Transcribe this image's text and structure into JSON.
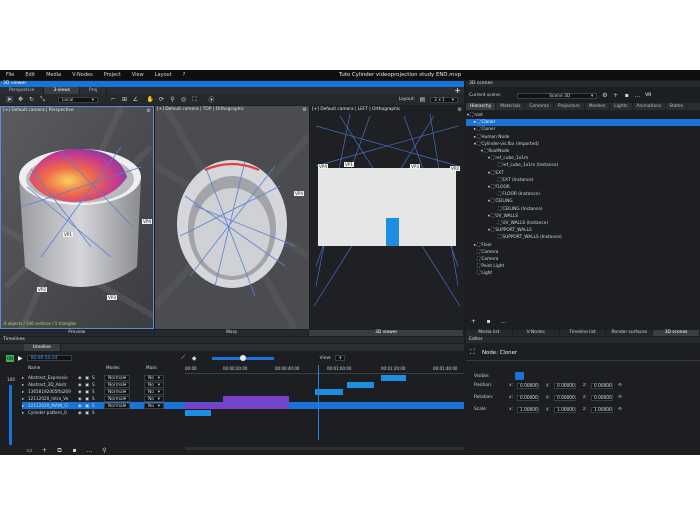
{
  "app_title": "Tuto Cylinder videoprojection study END.mvp",
  "menu": [
    "File",
    "Edit",
    "Media",
    "V-Nodes",
    "Project",
    "View",
    "Layout",
    "?"
  ],
  "viewer": {
    "header": "3D viewer",
    "tabs": [
      "Perspective",
      "3-views",
      "Proj"
    ],
    "local_label": "Local",
    "layout_label": "Layout:",
    "layout_value": "3 x 1",
    "views": [
      {
        "label": "[+] Default camera | Perspective",
        "footer": "Preview",
        "status": "6 objects / 346 vertices / 1 triangles"
      },
      {
        "label": "[+] Default camera | TOP | Orthographic",
        "footer": "Warp"
      },
      {
        "label": "[+] Default camera | LEFT | Orthographic",
        "footer": "3D viewer"
      }
    ],
    "vp_tags": [
      "VP1",
      "VP2",
      "VP3",
      "VP4"
    ]
  },
  "scenes": {
    "header": "3D scenes",
    "current_scene_label": "Current scene:",
    "current_scene_value": "Scene 3D",
    "vr_label": "VR",
    "tabs": [
      "Hierarchy",
      "Materials",
      "Cameras",
      "Projectors",
      "Meshes",
      "Lights",
      "Animations",
      "States"
    ],
    "tree": [
      {
        "label": "root",
        "depth": 0,
        "icon": "▾"
      },
      {
        "label": "Cloner",
        "depth": 1,
        "icon": "▸",
        "selected": true
      },
      {
        "label": "Cloner",
        "depth": 1,
        "icon": "▸"
      },
      {
        "label": "Human Node",
        "depth": 1,
        "icon": "▸"
      },
      {
        "label": "Cylinder-vis.fbx (Imported)",
        "depth": 1,
        "icon": "▾"
      },
      {
        "label": "RootNode",
        "depth": 2,
        "icon": "▾"
      },
      {
        "label": "ref_cube_1x1m",
        "depth": 3,
        "icon": "▾"
      },
      {
        "label": "ref_cube_1x1m (Instance)",
        "depth": 4,
        "icon": ""
      },
      {
        "label": "EXT",
        "depth": 3,
        "icon": "▾"
      },
      {
        "label": "EXT (Instance)",
        "depth": 4,
        "icon": ""
      },
      {
        "label": "FLOOR",
        "depth": 3,
        "icon": "▾"
      },
      {
        "label": "FLOOR (Instance)",
        "depth": 4,
        "icon": ""
      },
      {
        "label": "CEILING",
        "depth": 3,
        "icon": "▾"
      },
      {
        "label": "CEILING (Instance)",
        "depth": 4,
        "icon": ""
      },
      {
        "label": "UV_WALLS",
        "depth": 3,
        "icon": "▾"
      },
      {
        "label": "UV_WALLS (Instance)",
        "depth": 4,
        "icon": ""
      },
      {
        "label": "SUPPORT_WALLS",
        "depth": 3,
        "icon": "▾"
      },
      {
        "label": "SUPPORT_WALLS (Instance)",
        "depth": 4,
        "icon": ""
      },
      {
        "label": "Floor",
        "depth": 1,
        "icon": "▸"
      },
      {
        "label": "Camera",
        "depth": 1,
        "icon": ""
      },
      {
        "label": "Camera",
        "depth": 1,
        "icon": ""
      },
      {
        "label": "Point Light",
        "depth": 1,
        "icon": ""
      },
      {
        "label": "Light",
        "depth": 1,
        "icon": ""
      }
    ],
    "bottom_tabs": [
      "Media list",
      "V-Nodes",
      "Timeline list",
      "Render surfaces",
      "3D scenes"
    ]
  },
  "timelines": {
    "header": "Timelines",
    "tab": "timeline",
    "timecode": "00:00:50:24",
    "view_label": "View:",
    "zoom_value": "100",
    "columns": [
      "Name",
      "Modes",
      "Mask"
    ],
    "ruler": [
      "00:00",
      "00:00:20:00",
      "00:00:40:00",
      "00:01:00:00",
      "00:01:20:00",
      "00:01:40:00"
    ],
    "rows": [
      {
        "name": "Abstract_Expressio",
        "mode": "Normal",
        "mask": "No"
      },
      {
        "name": "Abstract_3D_Abstr",
        "mode": "Normal",
        "mask": "No"
      },
      {
        "name": "13658192005ffa269",
        "mode": "Normal",
        "mask": "No"
      },
      {
        "name": "12112020_Intro_Ve",
        "mode": "Normal",
        "mask": "No"
      },
      {
        "name": "12112020_MAIN_Ci",
        "mode": "Normal",
        "mask": "No",
        "selected": true
      },
      {
        "name": "Cylinder pattern_0",
        "mode": "",
        "mask": ""
      }
    ]
  },
  "editor": {
    "header": "Editor",
    "node_title": "Node: Cloner",
    "visible_label": "Visible:",
    "rows": [
      {
        "label": "Position:",
        "x": "0.00000",
        "y": "0.00000",
        "z": "0.00000"
      },
      {
        "label": "Rotation:",
        "x": "0.00000",
        "y": "0.00000",
        "z": "0.00000"
      },
      {
        "label": "Scale:",
        "x": "1.00000",
        "y": "1.00000",
        "z": "1.00000"
      }
    ]
  },
  "colors": {
    "accent": "#1a73d8",
    "purple": "#7c3fc7",
    "clip": "#1e8fe0"
  }
}
